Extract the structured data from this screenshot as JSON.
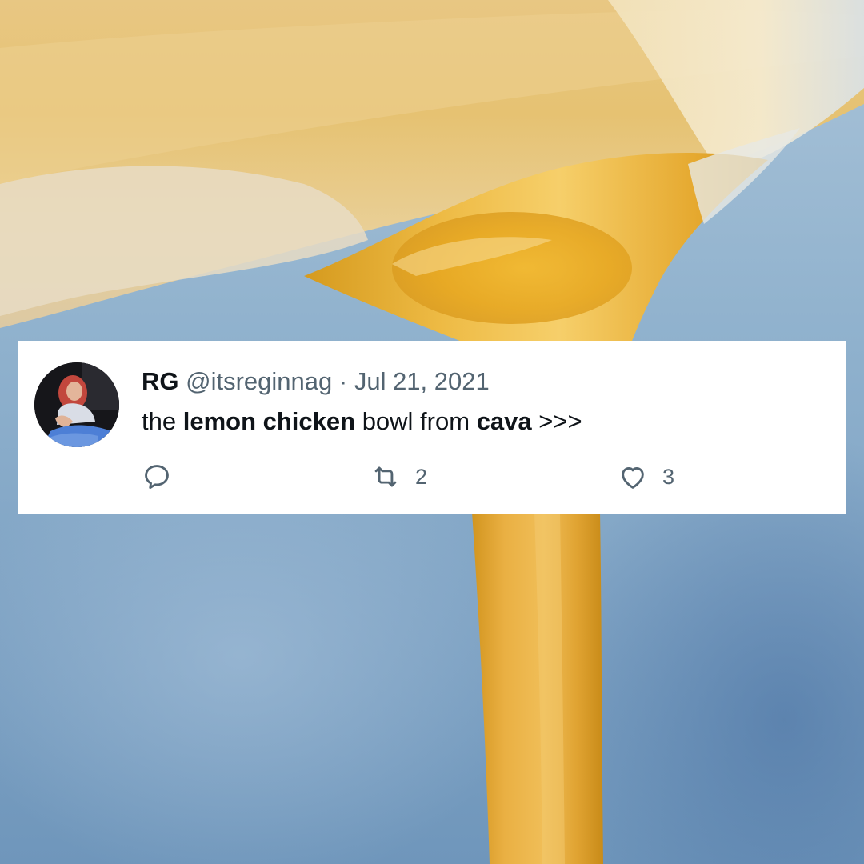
{
  "tweet": {
    "display_name": "RG",
    "handle": "@itsreginnag",
    "separator": "·",
    "date": "Jul 21, 2021",
    "text_parts": {
      "t1": "the ",
      "t2": "lemon chicken",
      "t3": " bowl from ",
      "t4": "cava",
      "t5": " >>>"
    },
    "actions": {
      "reply": {
        "icon": "reply-icon",
        "count": ""
      },
      "retweet": {
        "icon": "retweet-icon",
        "count": "2"
      },
      "like": {
        "icon": "heart-icon",
        "count": "3"
      }
    }
  },
  "colors": {
    "text_primary": "#0f1419",
    "text_secondary": "#536471",
    "card_background": "#ffffff",
    "background_sky": "#8fb1cd",
    "background_liquid": "#e9b43a"
  }
}
